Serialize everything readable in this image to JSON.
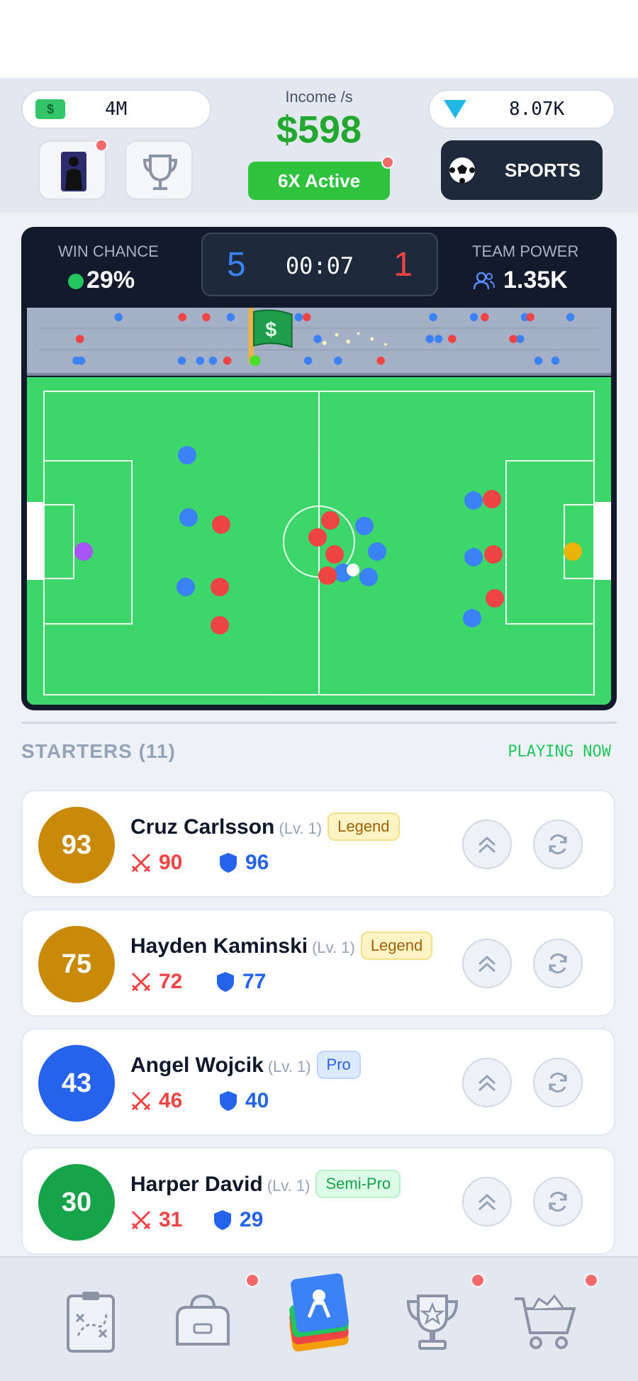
{
  "hud": {
    "cash": "4M",
    "gems": "8.07K",
    "income_label": "Income /s",
    "income_value": "$598",
    "boost_label": "6X Active",
    "sports_label": "SPORTS"
  },
  "match": {
    "win_chance_label": "WIN CHANCE",
    "win_chance_value": "29%",
    "team_power_label": "TEAM POWER",
    "team_power_value": "1.35K",
    "score_home": "5",
    "score_away": "1",
    "clock": "00:07"
  },
  "section": {
    "title": "STARTERS (11)",
    "status": "PLAYING NOW"
  },
  "players": [
    {
      "rating": "93",
      "name": "Cruz Carlsson",
      "level": "(Lv. 1)",
      "tier": "Legend",
      "attack": "90",
      "defense": "96"
    },
    {
      "rating": "75",
      "name": "Hayden Kaminski",
      "level": "(Lv. 1)",
      "tier": "Legend",
      "attack": "72",
      "defense": "77"
    },
    {
      "rating": "43",
      "name": "Angel Wojcik",
      "level": "(Lv. 1)",
      "tier": "Pro",
      "attack": "46",
      "defense": "40"
    },
    {
      "rating": "30",
      "name": "Harper David",
      "level": "(Lv. 1)",
      "tier": "Semi-Pro",
      "attack": "31",
      "defense": "29"
    }
  ],
  "nav": {
    "items": [
      "tactics-icon",
      "bag-icon",
      "cards-icon",
      "trophy-icon",
      "shop-cart-icon"
    ],
    "active": "cards-icon"
  },
  "colors": {
    "accent_green": "#22a82e",
    "home_team": "#3b82f6",
    "away_team": "#ef4444",
    "legend_badge": "#c98a0a",
    "pro_badge": "#2563eb",
    "semi_pro_badge": "#16a34a"
  }
}
